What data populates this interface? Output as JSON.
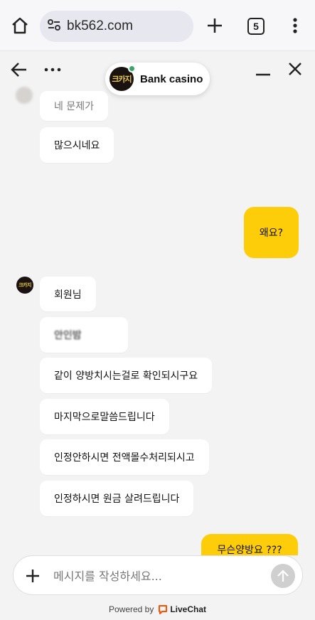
{
  "browser": {
    "url": "bk562.com",
    "tab_count": "5"
  },
  "chat": {
    "agent_name": "Bank casino",
    "agent_logo": "크카지",
    "online_color": "#3aa56b"
  },
  "messages": [
    {
      "text": "네 문제가",
      "from": "agent"
    },
    {
      "text": "많으시네요",
      "from": "agent"
    },
    {
      "text": "왜요?",
      "from": "user"
    },
    {
      "text": "회원님",
      "from": "agent"
    },
    {
      "text": "안인밤",
      "from": "agent"
    },
    {
      "text": "같이 양방치시는걸로 확인되시구요",
      "from": "agent"
    },
    {
      "text": "마지막으로말씀드립니다",
      "from": "agent"
    },
    {
      "text": "인정안하시면 전액몰수처리되시고",
      "from": "agent"
    },
    {
      "text": "인정하시면 원금 살려드립니다",
      "from": "agent"
    },
    {
      "text": "무슨양방요 ???",
      "from": "user"
    }
  ],
  "composer": {
    "placeholder": "메시지를 작성하세요..."
  },
  "footer": {
    "powered_by": "Powered by",
    "brand": "LiveChat"
  },
  "colors": {
    "user_bubble": "#fecd0a",
    "livechat_brand": "#ff5100"
  }
}
